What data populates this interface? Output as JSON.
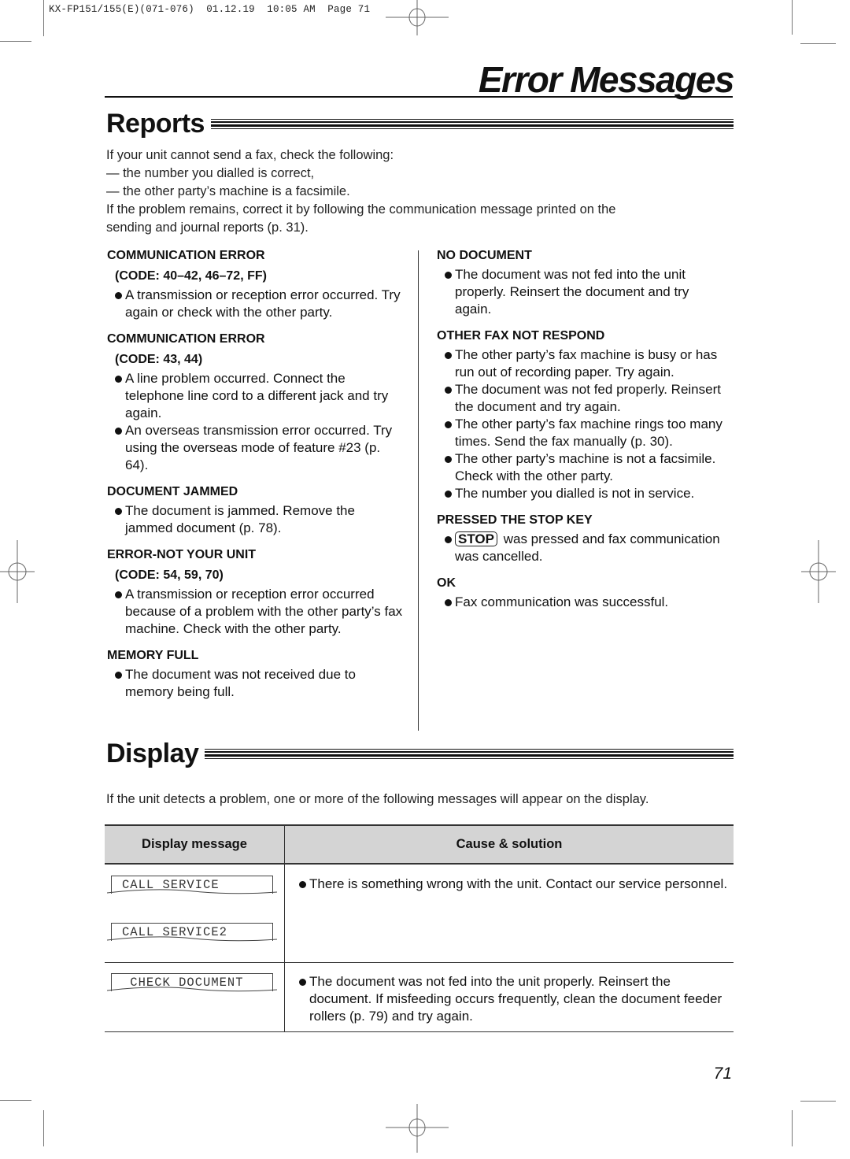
{
  "slug": "KX-FP151/155(E)(071-076)  01.12.19  10:05 AM  Page 71",
  "page_title": "Error Messages",
  "reports": {
    "heading": "Reports",
    "intro": [
      "If your unit cannot send a fax, check the following:",
      "— the number you dialled is correct,",
      "— the other party’s machine is a facsimile.",
      "If the problem remains, correct it by following the communication message printed on the",
      "sending and journal reports (p. 31)."
    ],
    "left_column": [
      {
        "title": "COMMUNICATION ERROR",
        "code": "(CODE: 40–42, 46–72, FF)",
        "bullets": [
          "A transmission or reception error occurred. Try again or check with the other party."
        ]
      },
      {
        "title": "COMMUNICATION ERROR",
        "code": "(CODE: 43, 44)",
        "bullets": [
          "A line problem occurred. Connect the telephone line cord to a different jack and try again.",
          "An overseas transmission error occurred. Try using the overseas mode of feature #23 (p. 64)."
        ]
      },
      {
        "title": "DOCUMENT JAMMED",
        "code": "",
        "bullets": [
          "The document is jammed. Remove the jammed document (p. 78)."
        ]
      },
      {
        "title": "ERROR-NOT YOUR UNIT",
        "code": "(CODE: 54, 59, 70)",
        "bullets": [
          "A transmission or reception error occurred because of a problem with the other party’s fax machine. Check with the other party."
        ]
      },
      {
        "title": "MEMORY FULL",
        "code": "",
        "bullets": [
          "The document was not received due to memory being full."
        ]
      }
    ],
    "right_column": [
      {
        "title": "NO DOCUMENT",
        "bullets": [
          "The document was not fed into the unit properly. Reinsert the document and try again."
        ]
      },
      {
        "title": "OTHER FAX NOT RESPOND",
        "bullets": [
          "The other party’s fax machine is busy or has run out of recording paper. Try again.",
          "The document was not fed properly. Reinsert the document and try again.",
          "The other party’s fax machine rings too many times. Send the fax manually (p. 30).",
          "The other party’s machine is not a facsimile. Check with the other party.",
          "The number you dialled is not in service."
        ]
      },
      {
        "title": "PRESSED THE STOP KEY",
        "key": "STOP",
        "bullets": [
          "was pressed and fax communication was cancelled."
        ]
      },
      {
        "title": "OK",
        "bullets": [
          "Fax communication was successful."
        ]
      }
    ]
  },
  "display": {
    "heading": "Display",
    "intro": "If the unit detects a problem, one or more of the following messages will appear on the display.",
    "table": {
      "headers": [
        "Display message",
        "Cause & solution"
      ],
      "rows": [
        {
          "messages": [
            "CALL SERVICE",
            "CALL SERVICE2"
          ],
          "cause": "There is something wrong with the unit. Contact our service personnel."
        },
        {
          "messages": [
            " CHECK DOCUMENT"
          ],
          "cause": "The document was not fed into the unit properly. Reinsert the document. If misfeeding occurs frequently, clean the document feeder rollers (p. 79) and try again."
        }
      ]
    }
  },
  "page_number": "71"
}
